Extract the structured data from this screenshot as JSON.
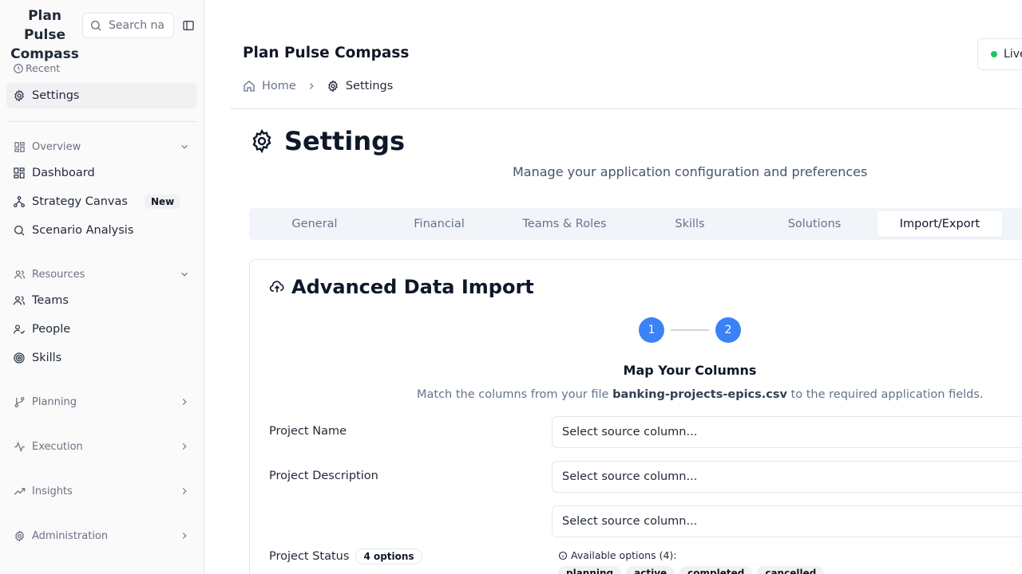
{
  "sidebar": {
    "brand": "Plan Pulse Compass",
    "search_placeholder": "Search na",
    "recent_label": "Recent",
    "recent_items": [
      {
        "label": "Settings"
      }
    ],
    "overview": {
      "label": "Overview",
      "items": [
        {
          "label": "Dashboard"
        },
        {
          "label": "Strategy Canvas",
          "badge": "New"
        },
        {
          "label": "Scenario Analysis"
        }
      ]
    },
    "resources": {
      "label": "Resources",
      "items": [
        {
          "label": "Teams"
        },
        {
          "label": "People"
        },
        {
          "label": "Skills"
        }
      ]
    },
    "groups": [
      {
        "label": "Planning"
      },
      {
        "label": "Execution"
      },
      {
        "label": "Insights"
      },
      {
        "label": "Administration"
      }
    ]
  },
  "header": {
    "title": "Plan Pulse Compass",
    "live_label": "Live",
    "breadcrumb": {
      "home": "Home",
      "current": "Settings"
    }
  },
  "page": {
    "title": "Settings",
    "subtitle": "Manage your application configuration and preferences",
    "tabs": [
      {
        "label": "General"
      },
      {
        "label": "Financial"
      },
      {
        "label": "Teams & Roles"
      },
      {
        "label": "Skills"
      },
      {
        "label": "Solutions"
      },
      {
        "label": "Import/Export",
        "active": true
      }
    ]
  },
  "import": {
    "title": "Advanced Data Import",
    "steps": [
      "1",
      "2"
    ],
    "map_title": "Map Your Columns",
    "map_desc_prefix": "Match the columns from your file ",
    "file_name": "banking-projects-epics.csv",
    "map_desc_suffix": " to the required application fields.",
    "fields": [
      {
        "label": "Project Name",
        "placeholder": "Select source column..."
      },
      {
        "label": "Project Description",
        "placeholder": "Select source column..."
      },
      {
        "label": "",
        "placeholder": "Select source column..."
      },
      {
        "label": "Project Status",
        "badge": "4 options"
      }
    ],
    "available_label": "Available options (4):",
    "options": [
      "planning",
      "active",
      "completed",
      "cancelled"
    ]
  },
  "colors": {
    "accent": "#3b82f6",
    "live": "#22c55e"
  }
}
